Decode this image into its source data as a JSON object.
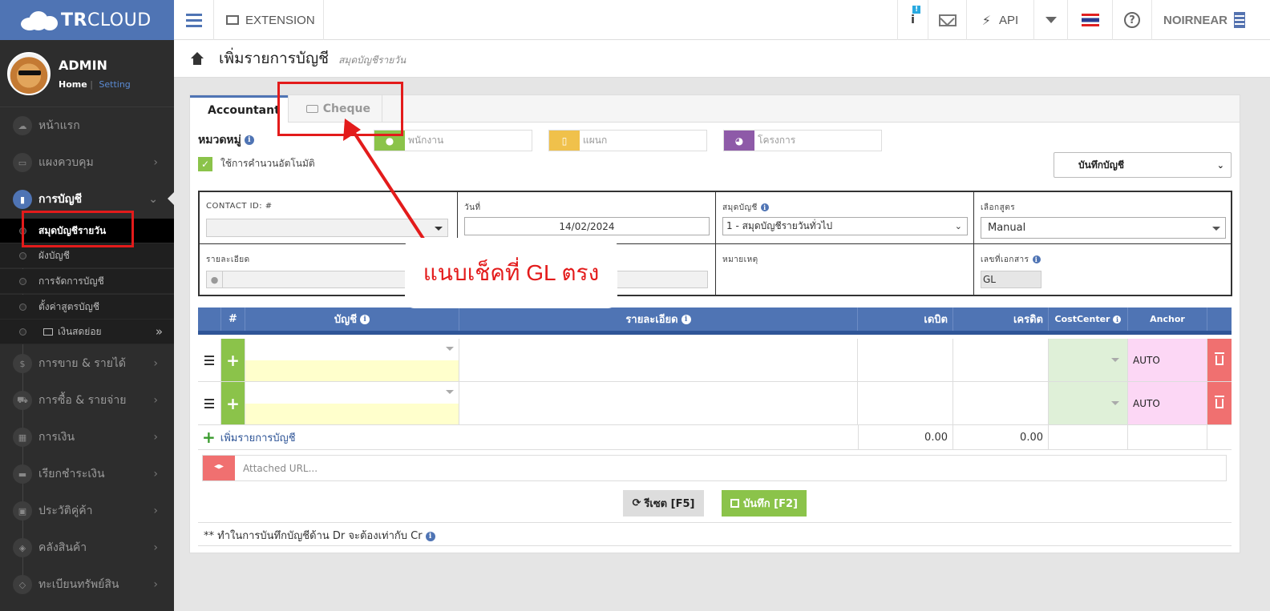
{
  "topbar": {
    "logo_bold": "TR",
    "logo_rest": "CLOUD",
    "extension_label": "EXTENSION",
    "notif_badge": "!",
    "api_label": "API",
    "username": "NOIRNEAR"
  },
  "sidebar": {
    "profile_name": "ADMIN",
    "home_link": "Home",
    "sep": "|",
    "setting_link": "Setting",
    "items": [
      {
        "label": "หน้าแรก"
      },
      {
        "label": "แผงควบคุม"
      },
      {
        "label": "การบัญชี"
      },
      {
        "label": "การขาย & รายได้"
      },
      {
        "label": "การซื้อ & รายจ่าย"
      },
      {
        "label": "การเงิน"
      },
      {
        "label": "เรียกชำระเงิน"
      },
      {
        "label": "ประวัติคู่ค้า"
      },
      {
        "label": "คลังสินค้า"
      },
      {
        "label": "ทะเบียนทรัพย์สิน"
      }
    ],
    "subitems": [
      {
        "label": "สมุดบัญชีรายวัน"
      },
      {
        "label": "ผังบัญชี"
      },
      {
        "label": "การจัดการบัญชี"
      },
      {
        "label": "ตั้งค่าสูตรบัญชี"
      },
      {
        "label": "เงินสดย่อย"
      }
    ]
  },
  "page": {
    "title": "เพิ่มรายการบัญชี",
    "subtitle": "สมุดบัญชีรายวัน"
  },
  "tabs": [
    {
      "label": "Accountant"
    },
    {
      "label": "Cheque"
    }
  ],
  "form": {
    "category_label": "หมวดหมู่",
    "employee_ph": "พนักงาน",
    "department_ph": "แผนก",
    "project_ph": "โครงการ",
    "auto_calc_label": "ใช้การคำนวนอัตโนมัติ",
    "top_select": "บันทึกบัญชี",
    "contact_label": "CONTACT ID: #",
    "date_label": "วันที่",
    "date_value": "14/02/2024",
    "journal_label": "สมุดบัญชี",
    "journal_value": "1 - สมุดบัญชีรายวันทั่วไป",
    "formula_label": "เลือกสูตร",
    "formula_value": "Manual",
    "detail_label": "รายละเอียด",
    "remark_label": "หมายเหตุ",
    "doc_label": "เลขที่เอกสาร",
    "doc_value": "GL"
  },
  "annotation": {
    "text": "แนบเช็คที่ GL ตรง"
  },
  "table": {
    "headers": {
      "num": "#",
      "account": "บัญชี",
      "detail": "รายละเอียด",
      "debit": "เดบิต",
      "credit": "เครดิต",
      "cost_center": "CostCenter",
      "anchor": "Anchor"
    },
    "rows": [
      {
        "anchor": "AUTO"
      },
      {
        "anchor": "AUTO"
      }
    ],
    "add_row": "เพิ่มรายการบัญชี",
    "total_debit": "0.00",
    "total_credit": "0.00"
  },
  "attach_ph": "Attached URL...",
  "buttons": {
    "reset": "รีเซต [F5]",
    "save": "บันทึก [F2]"
  },
  "note": "** ทำในการบันทึกบัญชีด้าน Dr จะต้องเท่ากับ Cr",
  "colors": {
    "brand": "#4f74b4",
    "green": "#8bc34a",
    "red": "#e31b1b"
  }
}
